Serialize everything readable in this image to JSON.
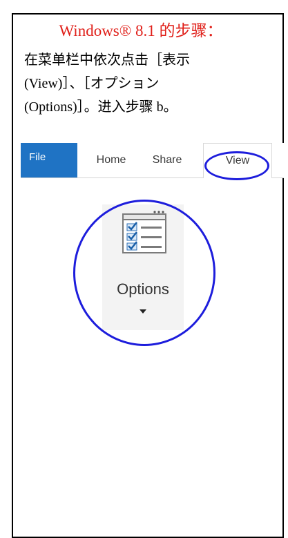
{
  "instructions": {
    "title": "Windows® 8.1 的步骤：",
    "lines": [
      "在菜单栏中依次点击［表示",
      "(View)］、［オプション",
      "(Options)］。进入步骤 b。"
    ]
  },
  "ribbon": {
    "tabs": [
      {
        "label": "File"
      },
      {
        "label": "Home"
      },
      {
        "label": "Share"
      },
      {
        "label": "View"
      }
    ]
  },
  "options_button": {
    "label": "Options",
    "icon": "options-checklist-icon"
  },
  "colors": {
    "title": "#e0201a",
    "highlight": "#1d1ddc",
    "file_tab": "#1f73c4"
  }
}
